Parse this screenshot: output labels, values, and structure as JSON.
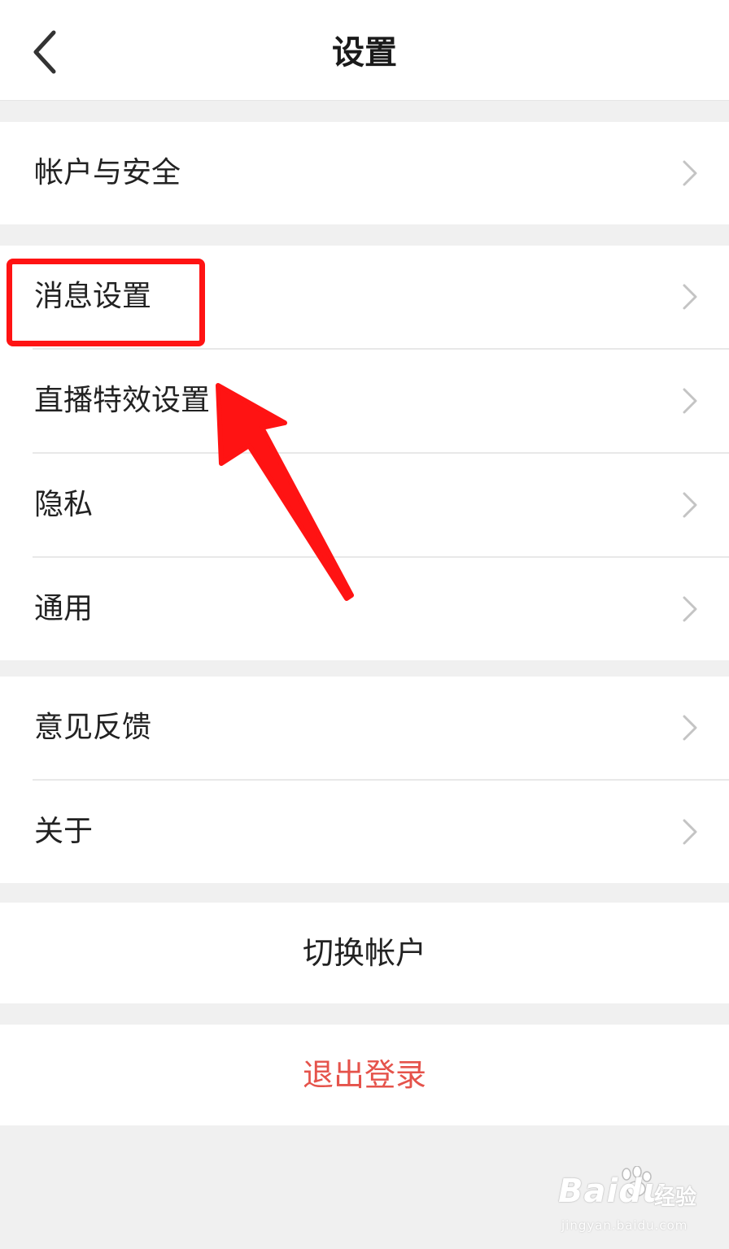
{
  "header": {
    "title": "设置",
    "back_icon": "chevron-left-icon"
  },
  "groups": [
    {
      "items": [
        {
          "label": "帐户与安全"
        }
      ]
    },
    {
      "items": [
        {
          "label": "消息设置"
        },
        {
          "label": "直播特效设置"
        },
        {
          "label": "隐私"
        },
        {
          "label": "通用"
        }
      ]
    },
    {
      "items": [
        {
          "label": "意见反馈"
        },
        {
          "label": "关于"
        }
      ]
    }
  ],
  "actions": {
    "switch_account": "切换帐户",
    "logout": "退出登录"
  },
  "colors": {
    "background": "#f0f0f0",
    "surface": "#ffffff",
    "text": "#222222",
    "logout": "#e5534b",
    "annotation": "#ff1313"
  },
  "annotation": {
    "highlighted_item": "消息设置"
  },
  "watermark": {
    "brand": "Baidu",
    "suffix": "经验",
    "url": "jingyan.baidu.com"
  }
}
